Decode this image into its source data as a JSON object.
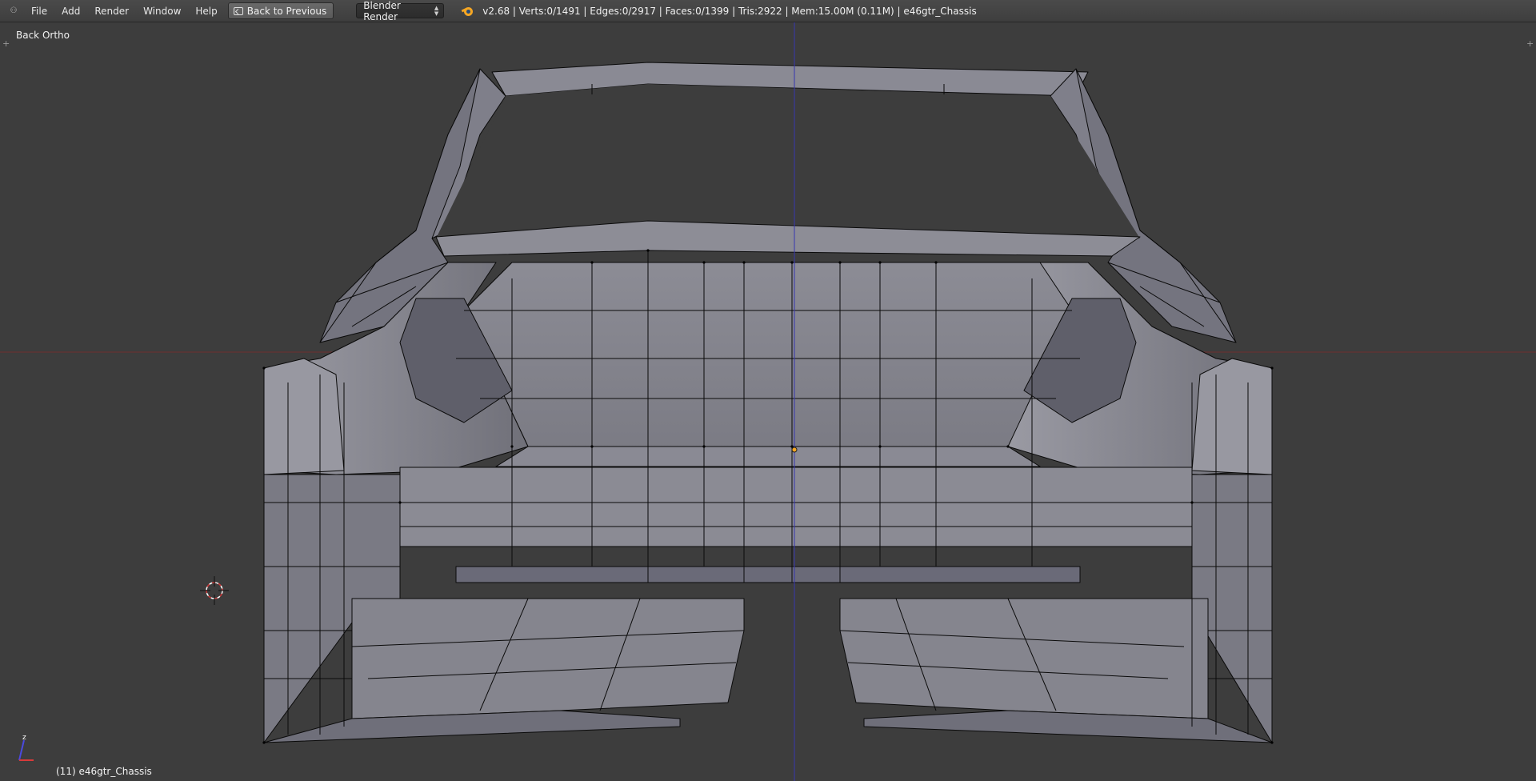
{
  "header": {
    "menus": [
      "File",
      "Add",
      "Render",
      "Window",
      "Help"
    ],
    "back_button": "Back to Previous",
    "render_engine": "Blender Render",
    "stats": "v2.68 | Verts:0/1491 | Edges:0/2917 | Faces:0/1399 | Tris:2922 | Mem:15.00M (0.11M) | e46gtr_Chassis"
  },
  "viewport": {
    "view_name": "Back Ortho",
    "active_object": "(11) e46gtr_Chassis",
    "axis_labels": {
      "z": "z"
    }
  },
  "icons": {
    "editor_type": "editor-type-icon",
    "back": "back-icon",
    "engine_dropdown": "updown-arrows-icon",
    "logo": "blender-logo-icon",
    "cursor": "3d-cursor-icon",
    "gizmo": "axis-gizmo-icon"
  },
  "colors": {
    "background": "#3d3d3d",
    "mesh_face": "#8e8e96",
    "mesh_face_dark": "#6e6e78",
    "mesh_edge": "#000000",
    "z_axis": "#3b3bb8",
    "x_axis": "#7a3030",
    "origin": "#f5a623"
  }
}
